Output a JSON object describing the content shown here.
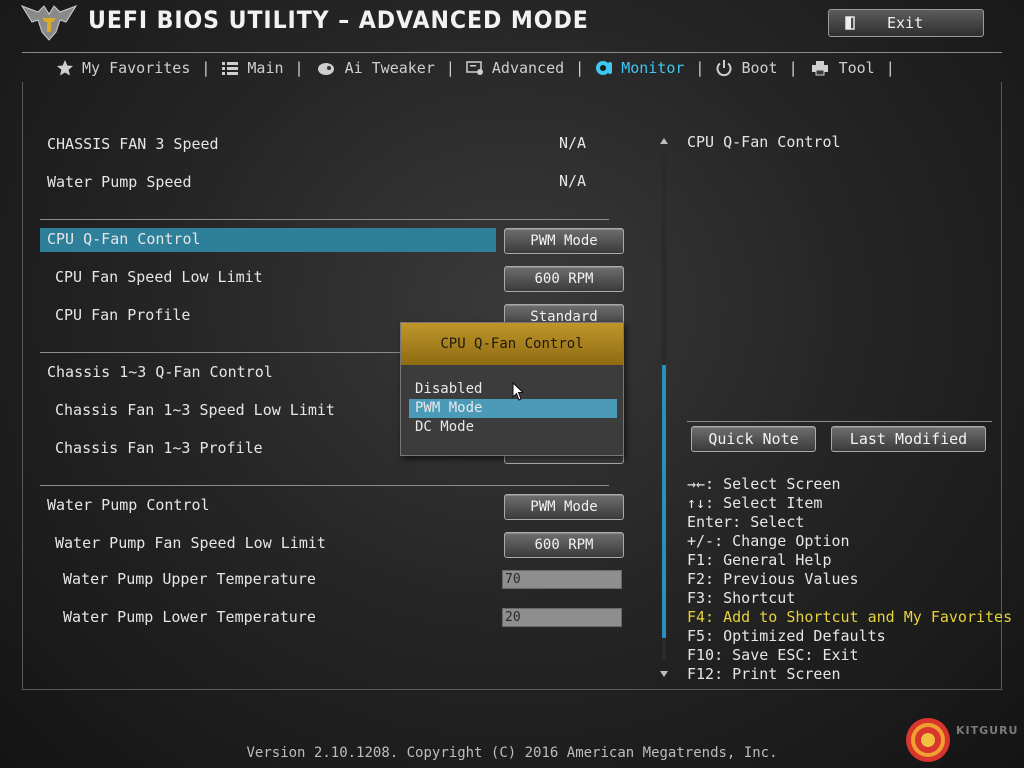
{
  "header": {
    "title": "UEFI BIOS UTILITY – ADVANCED MODE",
    "exit_label": "Exit"
  },
  "tabs": [
    {
      "label": "My Favorites",
      "icon": "star-icon"
    },
    {
      "label": "Main",
      "icon": "list-icon"
    },
    {
      "label": "Ai Tweaker",
      "icon": "tweaker-icon"
    },
    {
      "label": "Advanced",
      "icon": "advanced-icon"
    },
    {
      "label": "Monitor",
      "icon": "monitor-icon",
      "active": true
    },
    {
      "label": "Boot",
      "icon": "power-icon"
    },
    {
      "label": "Tool",
      "icon": "printer-icon"
    }
  ],
  "settings": {
    "chassis_fan3_speed": {
      "label": "CHASSIS FAN 3 Speed",
      "value": "N/A"
    },
    "water_pump_speed": {
      "label": "Water Pump Speed",
      "value": "N/A"
    },
    "cpu_qfan_control": {
      "label": "CPU Q-Fan Control",
      "value": "PWM Mode"
    },
    "cpu_fan_low_limit": {
      "label": "CPU Fan Speed Low Limit",
      "value": "600 RPM"
    },
    "cpu_fan_profile": {
      "label": "CPU Fan Profile",
      "value": "Standard"
    },
    "chassis_qfan_control": {
      "label": "Chassis 1~3 Q-Fan Control"
    },
    "chassis_fan_low_limit": {
      "label": "Chassis Fan 1~3 Speed Low Limit"
    },
    "chassis_fan_profile": {
      "label": "Chassis Fan 1~3 Profile"
    },
    "water_pump_control": {
      "label": "Water Pump Control",
      "value": "PWM Mode"
    },
    "water_pump_low_limit": {
      "label": "Water Pump Fan Speed Low Limit",
      "value": "600 RPM"
    },
    "water_pump_upper_temp": {
      "label": "Water Pump Upper Temperature",
      "value": "70"
    },
    "water_pump_lower_temp": {
      "label": "Water Pump Lower Temperature",
      "value": "20"
    }
  },
  "dropdown": {
    "title": "CPU Q-Fan Control",
    "options": [
      "Disabled",
      "PWM Mode",
      "DC Mode"
    ],
    "selected": "PWM Mode"
  },
  "help_panel": {
    "description": "CPU Q-Fan Control",
    "quick_note": "Quick Note",
    "last_modified": "Last Modified",
    "keys": [
      "→←: Select Screen",
      "↑↓: Select Item",
      "Enter: Select",
      "+/-: Change Option",
      "F1: General Help",
      "F2: Previous Values",
      "F3: Shortcut",
      "F4: Add to Shortcut and My Favorites",
      "F5: Optimized Defaults",
      "F10: Save  ESC: Exit",
      "F12: Print Screen"
    ]
  },
  "footer": {
    "version": "Version 2.10.1208. Copyright (C) 2016 American Megatrends, Inc.",
    "watermark": "KITGURU"
  },
  "colors": {
    "accent": "#3ec7f0",
    "selection": "#2e7f99",
    "popup_title": "#b08a22",
    "highlight_key": "#e6d23a"
  }
}
